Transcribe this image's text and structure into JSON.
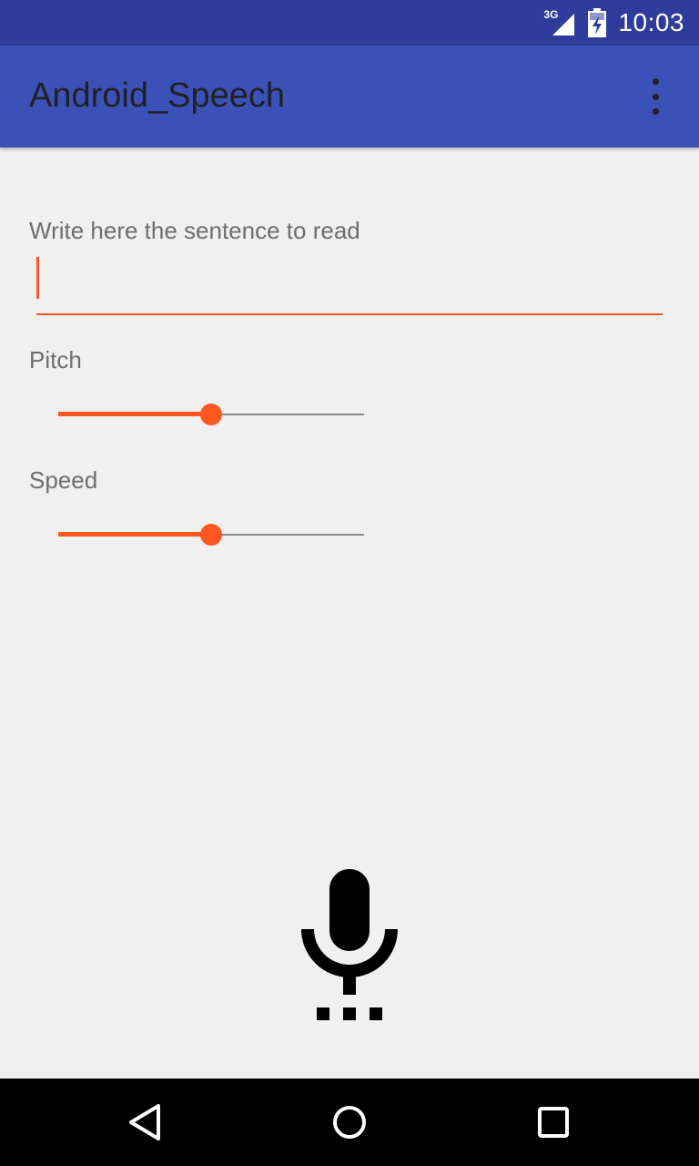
{
  "status_bar": {
    "network": "3G",
    "time": "10:03",
    "icons": [
      "signal-icon",
      "battery-charging-icon"
    ]
  },
  "app_bar": {
    "title": "Android_Speech",
    "overflow_icon": "more-vert-icon"
  },
  "form": {
    "sentence_label": "Write here the sentence to read",
    "sentence_value": "",
    "pitch_label": "Pitch",
    "pitch_value": 0.5,
    "speed_label": "Speed",
    "speed_value": 0.5
  },
  "mic": {
    "icon": "mic-icon"
  },
  "nav_bar": {
    "icons": [
      "back-icon",
      "home-icon",
      "recents-icon"
    ]
  },
  "colors": {
    "status_bar": "#2f3c9c",
    "app_bar": "#3b51b7",
    "accent": "#ff5722",
    "background": "#f0f0f0"
  }
}
